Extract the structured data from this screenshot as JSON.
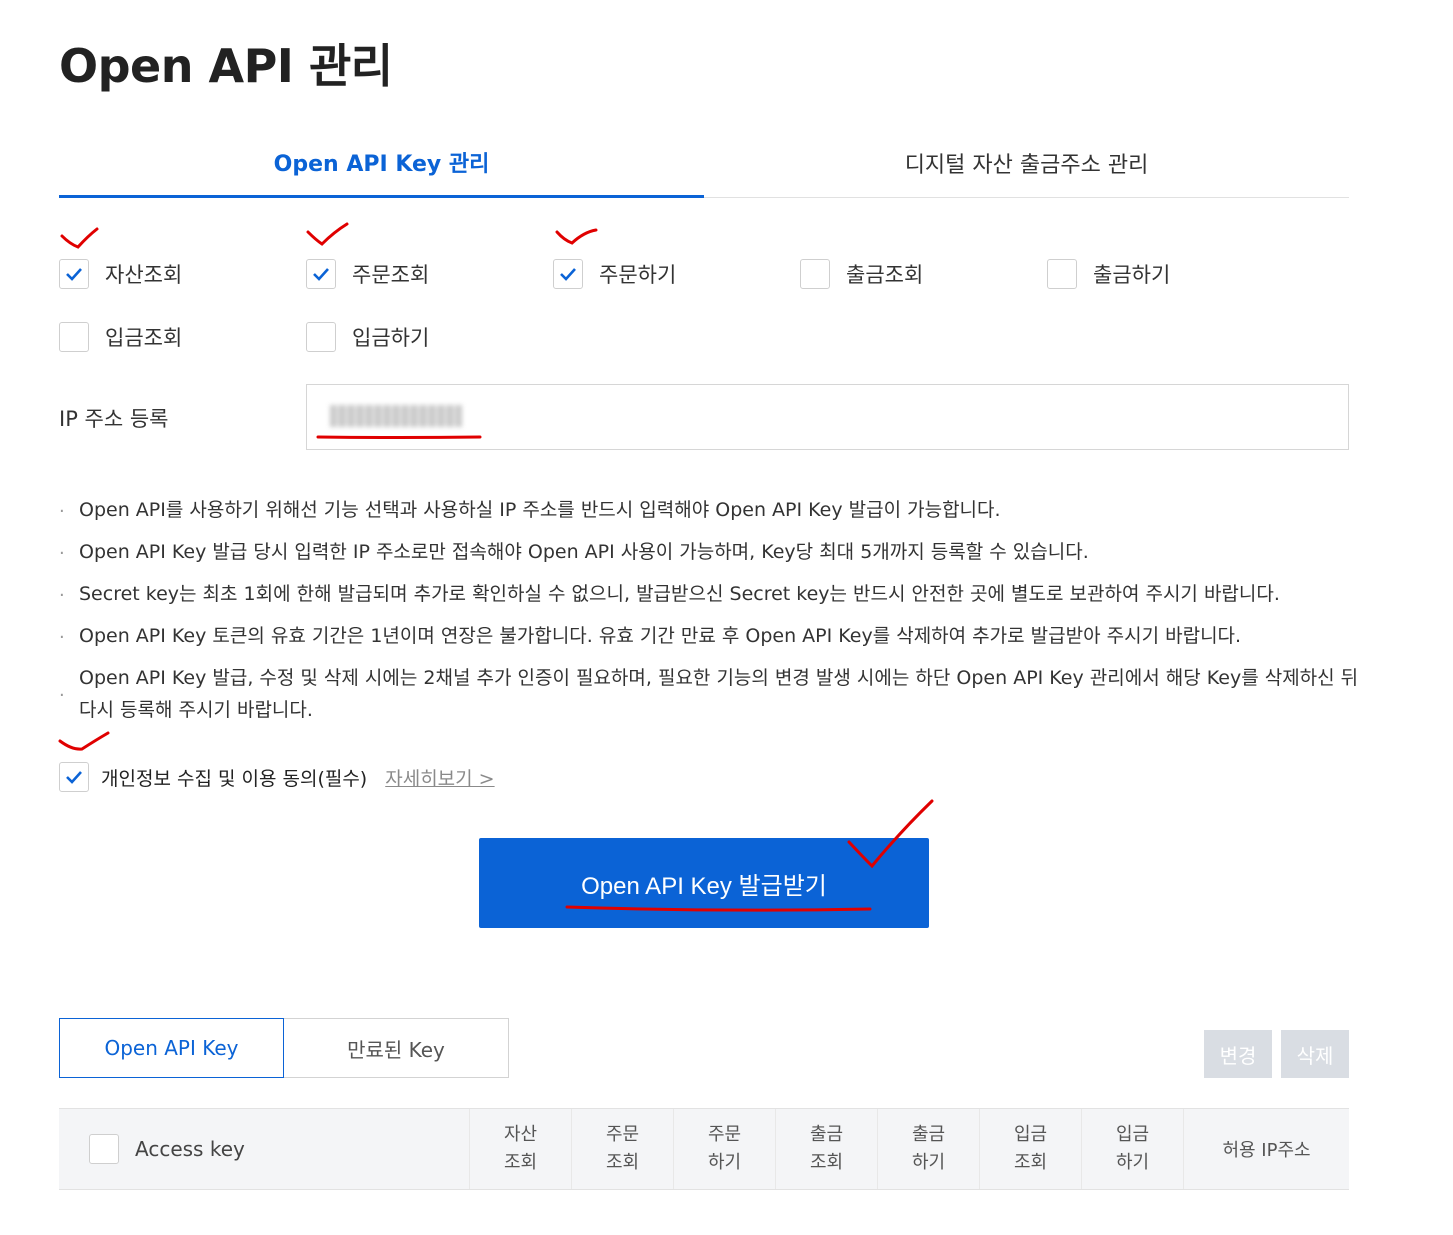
{
  "page": {
    "title": "Open API 관리"
  },
  "tabs": [
    {
      "label": "Open API Key 관리",
      "active": true
    },
    {
      "label": "디지털 자산 출금주소 관리",
      "active": false
    }
  ],
  "permissions": [
    {
      "label": "자산조회",
      "checked": true
    },
    {
      "label": "주문조회",
      "checked": true
    },
    {
      "label": "주문하기",
      "checked": true
    },
    {
      "label": "출금조회",
      "checked": false
    },
    {
      "label": "출금하기",
      "checked": false
    },
    {
      "label": "입금조회",
      "checked": false
    },
    {
      "label": "입금하기",
      "checked": false
    }
  ],
  "ip": {
    "label": "IP 주소 등록",
    "value": ""
  },
  "notes": [
    "Open API를 사용하기 위해선 기능 선택과 사용하실 IP 주소를 반드시 입력해야 Open API Key 발급이 가능합니다.",
    "Open API Key 발급 당시 입력한 IP 주소로만 접속해야 Open API 사용이 가능하며, Key당 최대 5개까지 등록할 수 있습니다.",
    "Secret key는 최초 1회에 한해 발급되며 추가로 확인하실 수 없으니, 발급받으신 Secret key는 반드시 안전한 곳에 별도로 보관하여 주시기 바랍니다.",
    "Open API Key 토큰의 유효 기간은 1년이며 연장은 불가합니다. 유효 기간 만료 후 Open API Key를 삭제하여 추가로 발급받아 주시기 바랍니다.",
    "Open API Key 발급, 수정 및 삭제 시에는 2채널 추가 인증이 필요하며, 필요한 기능의 변경 발생 시에는 하단 Open API Key 관리에서 해당 Key를 삭제하신 뒤 다시 등록해 주시기 바랍니다."
  ],
  "consent": {
    "label": "개인정보 수집 및 이용 동의(필수)",
    "link": "자세히보기 >",
    "checked": true
  },
  "issue_button": "Open API Key 발급받기",
  "key_tabs": [
    {
      "label": "Open API Key",
      "active": true
    },
    {
      "label": "만료된 Key",
      "active": false
    }
  ],
  "actions": {
    "change": "변경",
    "delete": "삭제"
  },
  "table": {
    "access_key": "Access key",
    "columns": [
      [
        "자산",
        "조회"
      ],
      [
        "주문",
        "조회"
      ],
      [
        "주문",
        "하기"
      ],
      [
        "출금",
        "조회"
      ],
      [
        "출금",
        "하기"
      ],
      [
        "입금",
        "조회"
      ],
      [
        "입금",
        "하기"
      ]
    ],
    "ip_column": "허용 IP주소"
  },
  "colors": {
    "accent": "#0b63d6",
    "disabled": "#d9dde3",
    "annotation": "#e00000"
  }
}
